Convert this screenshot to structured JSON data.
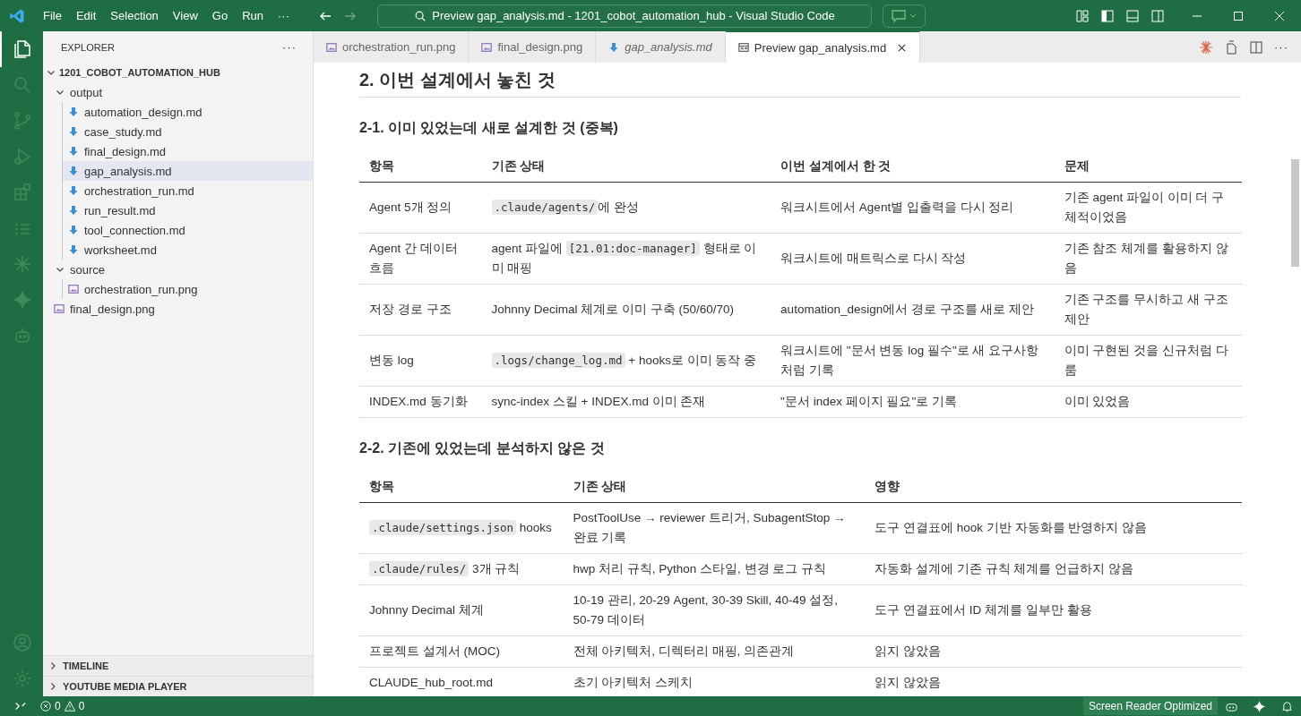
{
  "menu": [
    "File",
    "Edit",
    "Selection",
    "View",
    "Go",
    "Run",
    "···"
  ],
  "title_search": "Preview gap_analysis.md - 1201_cobot_automation_hub - Visual Studio Code",
  "activity_bar": [
    {
      "kind": "files",
      "selected": true
    },
    {
      "kind": "search",
      "selected": false
    },
    {
      "kind": "branch",
      "selected": false
    },
    {
      "kind": "debug",
      "selected": false
    },
    {
      "kind": "extensions",
      "selected": false
    },
    {
      "kind": "list",
      "selected": false
    },
    {
      "kind": "burst",
      "selected": false
    },
    {
      "kind": "sparkle",
      "selected": false
    },
    {
      "kind": "robot",
      "selected": false
    }
  ],
  "sidebar": {
    "title": "EXPLORER",
    "more": "···",
    "root": {
      "label": "1201_COBOT_AUTOMATION_HUB",
      "expanded": true,
      "children": [
        {
          "label": "output",
          "kind": "folder",
          "expanded": true,
          "children": [
            {
              "label": "automation_design.md",
              "kind": "markdown",
              "selected": false
            },
            {
              "label": "case_study.md",
              "kind": "markdown",
              "selected": false
            },
            {
              "label": "final_design.md",
              "kind": "markdown",
              "selected": false
            },
            {
              "label": "gap_analysis.md",
              "kind": "markdown",
              "selected": true
            },
            {
              "label": "orchestration_run.md",
              "kind": "markdown",
              "selected": false
            },
            {
              "label": "run_result.md",
              "kind": "markdown",
              "selected": false
            },
            {
              "label": "tool_connection.md",
              "kind": "markdown",
              "selected": false
            },
            {
              "label": "worksheet.md",
              "kind": "markdown",
              "selected": false
            }
          ]
        },
        {
          "label": "source",
          "kind": "folder",
          "expanded": true,
          "children": [
            {
              "label": "orchestration_run.png",
              "kind": "image",
              "selected": false
            }
          ]
        },
        {
          "label": "final_design.png",
          "kind": "image",
          "selected": false
        }
      ]
    },
    "panels": [
      {
        "label": "TIMELINE",
        "expanded": false
      },
      {
        "label": "YOUTUBE MEDIA PLAYER",
        "expanded": false
      }
    ]
  },
  "tabs": [
    {
      "label": "orchestration_run.png",
      "kind": "image",
      "italic": false,
      "selected": false
    },
    {
      "label": "final_design.png",
      "kind": "image",
      "italic": false,
      "selected": false
    },
    {
      "label": "gap_analysis.md",
      "kind": "markdown",
      "italic": true,
      "selected": false
    },
    {
      "label": "Preview gap_analysis.md",
      "kind": "preview",
      "italic": false,
      "selected": true
    }
  ],
  "tab_actions_more": "···",
  "document": {
    "heading": "2. 이번 설계에서 놓친 것",
    "sections": [
      {
        "heading": "2-1. 이미 있었는데 새로 설계한 것 (중복)",
        "columns": [
          "항목",
          "기존 상태",
          "이번 설계에서 한 것",
          "문제"
        ],
        "rows": [
          [
            [
              {
                "kind": "text",
                "text": "Agent 5개 정의"
              }
            ],
            [
              {
                "kind": "code",
                "text": ".claude/agents/"
              },
              {
                "kind": "text",
                "text": "에 완성"
              }
            ],
            [
              {
                "kind": "text",
                "text": "워크시트에서 Agent별 입출력을 다시 정리"
              }
            ],
            [
              {
                "kind": "text",
                "text": "기존 agent 파일이 이미 더 구체적이었음"
              }
            ]
          ],
          [
            [
              {
                "kind": "text",
                "text": "Agent 간 데이터 흐름"
              }
            ],
            [
              {
                "kind": "text",
                "text": "agent 파일에 "
              },
              {
                "kind": "code",
                "text": "[21.01:doc-manager]"
              },
              {
                "kind": "text",
                "text": " 형태로 이미 매핑"
              }
            ],
            [
              {
                "kind": "text",
                "text": "워크시트에 매트릭스로 다시 작성"
              }
            ],
            [
              {
                "kind": "text",
                "text": "기존 참조 체계를 활용하지 않음"
              }
            ]
          ],
          [
            [
              {
                "kind": "text",
                "text": "저장 경로 구조"
              }
            ],
            [
              {
                "kind": "text",
                "text": "Johnny Decimal 체계로 이미 구축 (50/60/70)"
              }
            ],
            [
              {
                "kind": "text",
                "text": "automation_design에서 경로 구조를 새로 제안"
              }
            ],
            [
              {
                "kind": "text",
                "text": "기존 구조를 무시하고 새 구조 제안"
              }
            ]
          ],
          [
            [
              {
                "kind": "text",
                "text": "변동 log"
              }
            ],
            [
              {
                "kind": "code",
                "text": ".logs/change_log.md"
              },
              {
                "kind": "text",
                "text": " + hooks로 이미 동작 중"
              }
            ],
            [
              {
                "kind": "text",
                "text": "워크시트에 \"문서 변동 log 필수\"로 새 요구사항처럼 기록"
              }
            ],
            [
              {
                "kind": "text",
                "text": "이미 구현된 것을 신규처럼 다룸"
              }
            ]
          ],
          [
            [
              {
                "kind": "text",
                "text": "INDEX.md 동기화"
              }
            ],
            [
              {
                "kind": "text",
                "text": "sync-index 스킬 + INDEX.md 이미 존재"
              }
            ],
            [
              {
                "kind": "text",
                "text": "\"문서 index 페이지 필요\"로 기록"
              }
            ],
            [
              {
                "kind": "text",
                "text": "이미 있었음"
              }
            ]
          ]
        ]
      },
      {
        "heading": "2-2. 기존에 있었는데 분석하지 않은 것",
        "columns": [
          "항목",
          "기존 상태",
          "영향"
        ],
        "rows": [
          [
            [
              {
                "kind": "code",
                "text": ".claude/settings.json"
              },
              {
                "kind": "text",
                "text": " hooks"
              }
            ],
            [
              {
                "kind": "text",
                "text": "PostToolUse → reviewer 트리거, SubagentStop → 완료 기록"
              }
            ],
            [
              {
                "kind": "text",
                "text": "도구 연결표에 hook 기반 자동화를 반영하지 않음"
              }
            ]
          ],
          [
            [
              {
                "kind": "code",
                "text": ".claude/rules/"
              },
              {
                "kind": "text",
                "text": " 3개 규칙"
              }
            ],
            [
              {
                "kind": "text",
                "text": "hwp 처리 규칙, Python 스타일, 변경 로그 규칙"
              }
            ],
            [
              {
                "kind": "text",
                "text": "자동화 설계에 기존 규칙 체계를 언급하지 않음"
              }
            ]
          ],
          [
            [
              {
                "kind": "text",
                "text": "Johnny Decimal 체계"
              }
            ],
            [
              {
                "kind": "text",
                "text": "10-19 관리, 20-29 Agent, 30-39 Skill, 40-49 설정, 50-79 데이터"
              }
            ],
            [
              {
                "kind": "text",
                "text": "도구 연결표에서 ID 체계를 일부만 활용"
              }
            ]
          ],
          [
            [
              {
                "kind": "text",
                "text": "프로젝트 설계서 (MOC)"
              }
            ],
            [
              {
                "kind": "text",
                "text": "전체 아키텍처, 디렉터리 매핑, 의존관계"
              }
            ],
            [
              {
                "kind": "text",
                "text": "읽지 않았음"
              }
            ]
          ],
          [
            [
              {
                "kind": "text",
                "text": "CLAUDE_hub_root.md"
              }
            ],
            [
              {
                "kind": "text",
                "text": "초기 아키텍처 스케치"
              }
            ],
            [
              {
                "kind": "text",
                "text": "읽지 않았음"
              }
            ]
          ]
        ]
      }
    ]
  },
  "status_bar": {
    "errors": "0",
    "warnings": "0",
    "mode": "Screen Reader Optimized"
  }
}
